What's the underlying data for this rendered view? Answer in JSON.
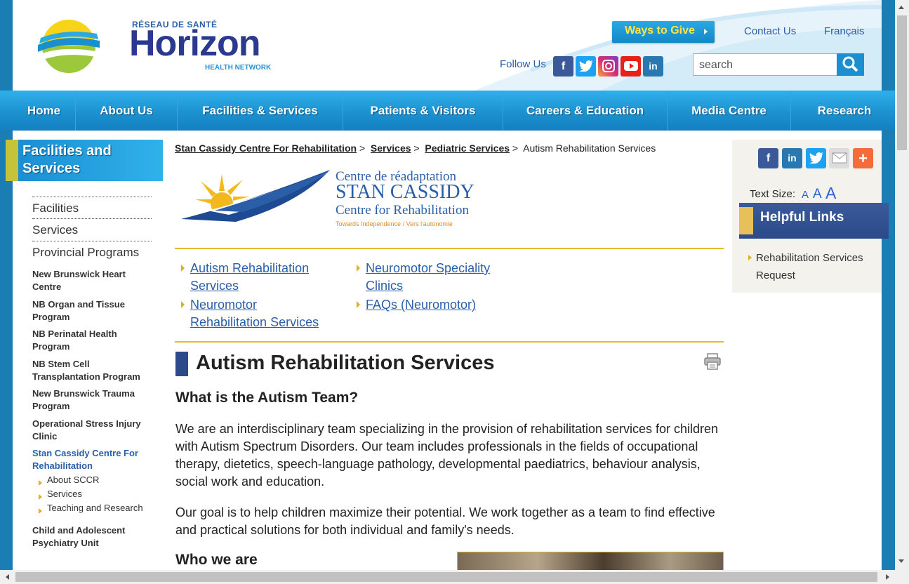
{
  "header": {
    "logo": {
      "top_line": "RÉSEAU DE SANTÉ",
      "main": "Horizon",
      "bottom_line": "HEALTH NETWORK"
    },
    "ways_to_give": "Ways to Give",
    "contact": "Contact Us",
    "language": "Français",
    "follow_label": "Follow Us",
    "social_icons": [
      "facebook-icon",
      "twitter-icon",
      "instagram-icon",
      "youtube-icon",
      "linkedin-icon"
    ],
    "search_placeholder": "search"
  },
  "nav": [
    "Home",
    "About Us",
    "Facilities & Services",
    "Patients & Visitors",
    "Careers & Education",
    "Media Centre",
    "Research"
  ],
  "sidebar": {
    "title": "Facilities and Services",
    "main_items": [
      "Facilities",
      "Services",
      "Provincial Programs"
    ],
    "programs": [
      "New Brunswick Heart Centre",
      "NB Organ and Tissue Program",
      "NB Perinatal Health Program",
      "NB Stem Cell Transplantation Program",
      "New Brunswick Trauma Program",
      "Operational Stress Injury Clinic",
      "Stan Cassidy Centre For Rehabilitation"
    ],
    "children": [
      "About SCCR",
      "Services",
      "Teaching and Research"
    ],
    "last_item": "Child and Adolescent Psychiatry Unit"
  },
  "breadcrumb": [
    "Stan Cassidy Centre For Rehabilitation",
    "Services",
    "Pediatric Services",
    "Autism Rehabilitation Services"
  ],
  "scc_logo": {
    "line1": "Centre de réadaptation",
    "line2": "STAN CASSIDY",
    "line3": "Centre for Rehabilitation",
    "tagline": "Towards Independence / Vers l'autonomie"
  },
  "sub_links": {
    "col1": [
      "Autism Rehabilitation Services",
      "Neuromotor Rehabilitation Services"
    ],
    "col2": [
      "Neuromotor Speciality Clinics",
      "FAQs (Neuromotor)"
    ]
  },
  "content": {
    "title": "Autism Rehabilitation Services",
    "h2_1": "What is the Autism Team?",
    "p1": "We are an interdisciplinary team specializing in the provision of rehabilitation services for children with Autism Spectrum Disorders. Our team includes professionals in the fields of occupational therapy, dietetics, speech-language pathology, developmental paediatrics, behaviour analysis, social work and education.",
    "p2": "Our goal is to help children maximize their potential. We work together as a team to find effective and practical solutions for both individual and family's needs.",
    "h2_2": "Who we are"
  },
  "right": {
    "share_icons": [
      "facebook-icon",
      "linkedin-icon",
      "twitter-icon",
      "email-icon",
      "plus-icon"
    ],
    "text_size_label": "Text Size:",
    "text_size_letter": "A",
    "helpful_title": "Helpful Links",
    "helpful_link": "Rehabilitation Services Request"
  }
}
